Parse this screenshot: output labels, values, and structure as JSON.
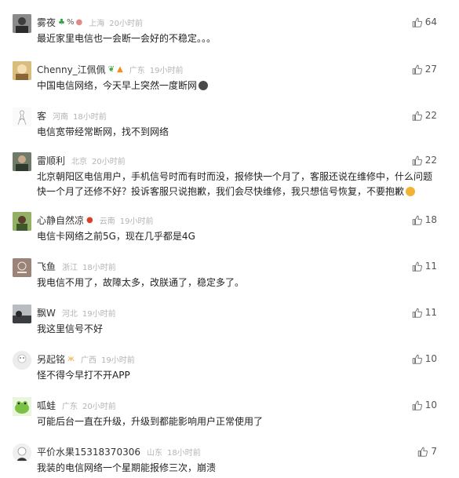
{
  "comments": [
    {
      "user": "雾夜",
      "badges": [
        "🍀",
        "%",
        "🐷"
      ],
      "location": "上海",
      "time": "20小时前",
      "text": "最近家里电信也一会断一会好的不稳定。。。",
      "likes": "64",
      "avatar_color": "#6b6b6b"
    },
    {
      "user": "Chenny_江佩佩",
      "badges": [
        "🌿",
        "🔥"
      ],
      "location": "广东",
      "time": "19小时前",
      "text": "中国电信网络，今天早上突然一度断网",
      "likes": "27",
      "avatar_color": "#c7a46a"
    },
    {
      "user": "客",
      "badges": [],
      "location": "河南",
      "time": "18小时前",
      "text": "电信宽带经常断网，找不到网络",
      "likes": "22",
      "avatar_color": "#f1f1f1"
    },
    {
      "user": "雷顺利",
      "badges": [],
      "location": "北京",
      "time": "20小时前",
      "text": "北京朝阳区电信用户，手机信号时而有时而没，报修快一个月了，客服还说在维修中，什么问题快一个月了还修不好？投诉客服只说抱歉，我们会尽快维修，我只想信号恢复，不要抱歉",
      "likes": "22",
      "avatar_color": "#4d5d4a"
    },
    {
      "user": "心静自然凉",
      "badges": [
        "🦀"
      ],
      "location": "云南",
      "time": "19小时前",
      "text": "电信卡网络之前5G，现在几乎都是4G",
      "likes": "18",
      "avatar_color": "#6e8a4f"
    },
    {
      "user": "飞鱼",
      "badges": [],
      "location": "浙江",
      "time": "18小时前",
      "text": "我电信不用了，故障太多，改朕通了，稳定多了。",
      "likes": "11",
      "avatar_color": "#8c7468"
    },
    {
      "user": "飘W",
      "badges": [],
      "location": "河北",
      "time": "19小时前",
      "text": "我这里信号不好",
      "likes": "11",
      "avatar_color": "#55585c"
    },
    {
      "user": "另起铭",
      "badges": [
        "🦋"
      ],
      "location": "广西",
      "time": "19小时前",
      "text": "怪不得今早打不开APP",
      "likes": "10",
      "avatar_color": "#dcdcdc"
    },
    {
      "user": "呱蛙",
      "badges": [],
      "location": "广东",
      "time": "20小时前",
      "text": "可能后台一直在升级，升级到都能影响用户正常使用了",
      "likes": "10",
      "avatar_color": "#7bc043"
    },
    {
      "user": "平价水果15318370306",
      "badges": [],
      "location": "山东",
      "time": "18小时前",
      "text": "我装的电信网络一个星期能报修三次，崩溃",
      "likes": "7",
      "avatar_color": "#e8e8e8"
    }
  ],
  "icons": {
    "like": "thumbs-up-icon"
  }
}
